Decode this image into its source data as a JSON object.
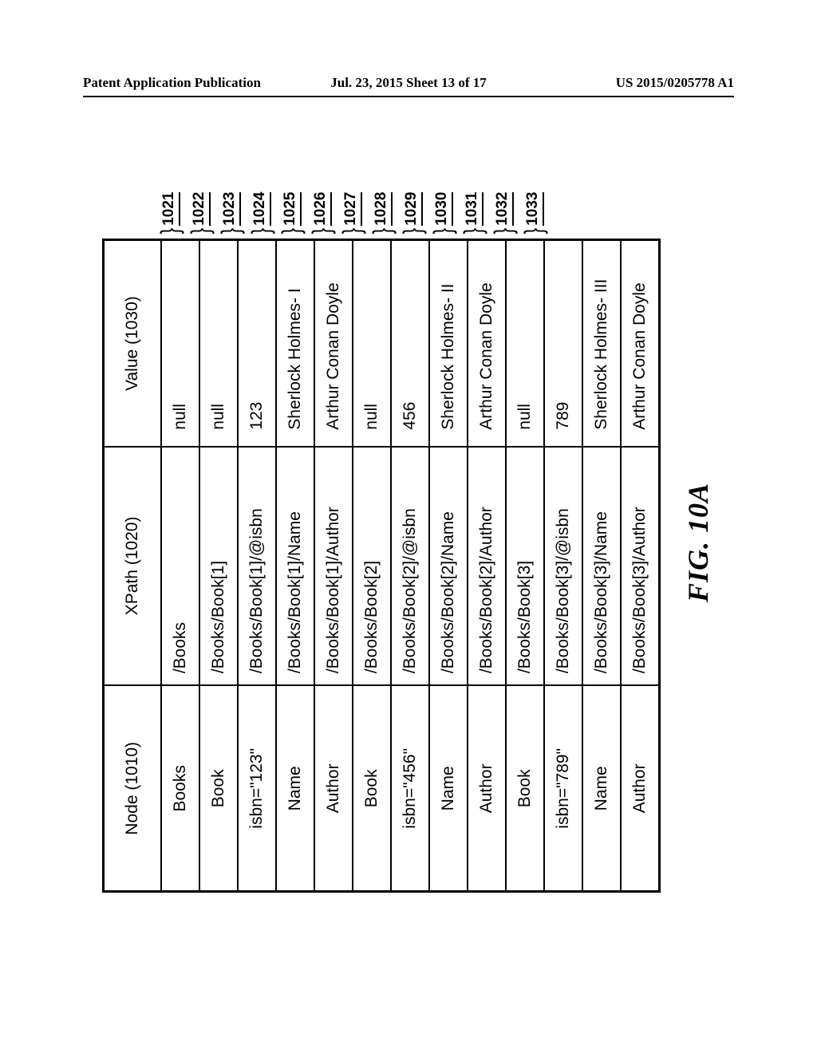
{
  "header": {
    "left": "Patent Application Publication",
    "center": "Jul. 23, 2015  Sheet 13 of 17",
    "right": "US 2015/0205778 A1"
  },
  "columns": {
    "node": "Node (1010)",
    "xpath": "XPath (1020)",
    "value": "Value (1030)"
  },
  "rows": [
    {
      "node": "Books",
      "xpath": "/Books",
      "value": "null",
      "ref": "1021"
    },
    {
      "node": "Book",
      "xpath": "/Books/Book[1]",
      "value": "null",
      "ref": "1022"
    },
    {
      "node": "isbn=\"123\"",
      "xpath": "/Books/Book[1]/@isbn",
      "value": "123",
      "ref": "1023"
    },
    {
      "node": "Name",
      "xpath": "/Books/Book[1]/Name",
      "value": "Sherlock Holmes- I",
      "ref": "1024"
    },
    {
      "node": "Author",
      "xpath": "/Books/Book[1]/Author",
      "value": "Arthur Conan Doyle",
      "ref": "1025"
    },
    {
      "node": "Book",
      "xpath": "/Books/Book[2]",
      "value": "null",
      "ref": "1026"
    },
    {
      "node": "isbn=\"456\"",
      "xpath": "/Books/Book[2]/@isbn",
      "value": "456",
      "ref": "1027"
    },
    {
      "node": "Name",
      "xpath": "/Books/Book[2]/Name",
      "value": "Sherlock Holmes- II",
      "ref": "1028"
    },
    {
      "node": "Author",
      "xpath": "/Books/Book[2]/Author",
      "value": "Arthur Conan Doyle",
      "ref": "1029"
    },
    {
      "node": "Book",
      "xpath": "/Books/Book[3]",
      "value": "null",
      "ref": "1030"
    },
    {
      "node": "isbn=\"789\"",
      "xpath": "/Books/Book[3]/@isbn",
      "value": "789",
      "ref": "1031"
    },
    {
      "node": "Name",
      "xpath": "/Books/Book[3]/Name",
      "value": "Sherlock Holmes- III",
      "ref": "1032"
    },
    {
      "node": "Author",
      "xpath": "/Books/Book[3]/Author",
      "value": "Arthur Conan Doyle",
      "ref": "1033"
    }
  ],
  "caption": "FIG. 10A"
}
